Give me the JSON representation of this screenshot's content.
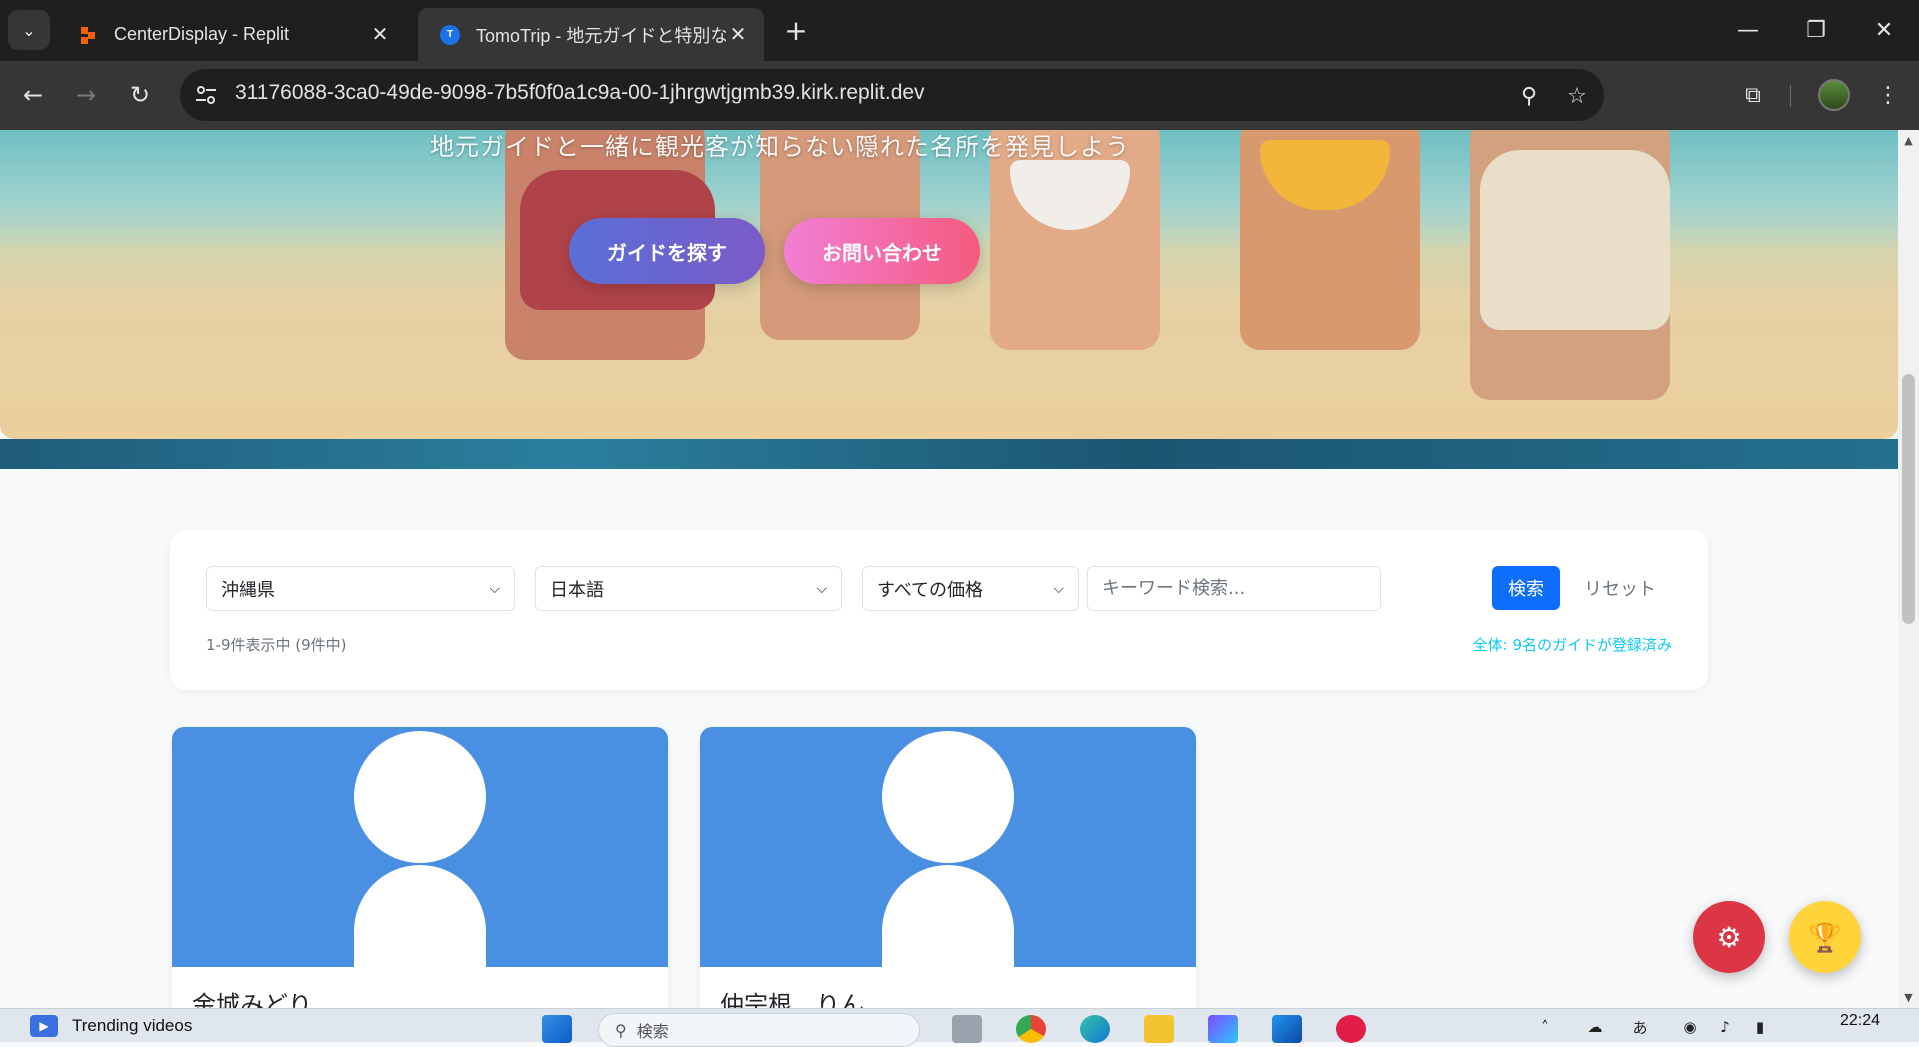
{
  "browser": {
    "tabs": [
      {
        "title": "CenterDisplay - Replit",
        "active": false
      },
      {
        "title": "TomoTrip - 地元ガイドと特別な旅",
        "active": true
      }
    ],
    "url": "31176088-3ca0-49de-9098-7b5f0f0a1c9a-00-1jhrgwtjgmb39.kirk.replit.dev",
    "favicon_tomo_letter": "T"
  },
  "hero": {
    "subtitle": "地元ガイドと一緒に観光客が知らない隠れた名所を発見しよう",
    "find_guide_button": "ガイドを探す",
    "contact_button": "お問い合わせ"
  },
  "filters": {
    "region": "沖縄県",
    "language": "日本語",
    "price": "すべての価格",
    "keyword_placeholder": "キーワード検索...",
    "search_button": "検索",
    "reset_button": "リセット",
    "result_count": "1-9件表示中 (9件中)",
    "total_registered": "全体: 9名のガイドが登録済み"
  },
  "guides": [
    {
      "name": "金城みどり"
    },
    {
      "name": "仲宗根　りん"
    }
  ],
  "taskbar": {
    "news_label": "Trending videos",
    "search_placeholder": "検索",
    "clock": "22:24"
  },
  "colors": {
    "primary": "#0d6efd",
    "card_photo_bg": "#4a90e2",
    "fab_settings": "#dc3545",
    "fab_trophy": "#ffd43b",
    "total_text": "#0dcaf0"
  }
}
